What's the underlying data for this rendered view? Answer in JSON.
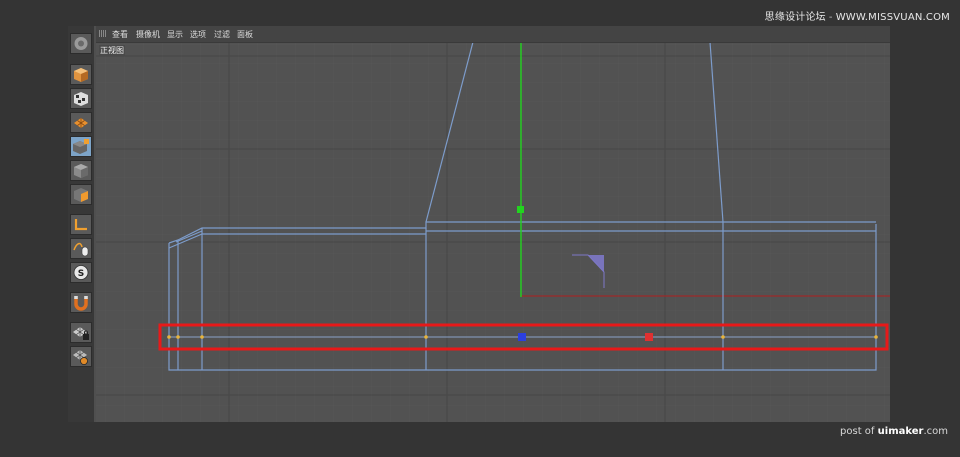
{
  "watermark_top": {
    "site_cn": "思缘设计论坛",
    "site_url": "WWW.MISSVUAN.COM"
  },
  "watermark_bottom": {
    "prefix": "post of",
    "brand": "uimaker",
    "suffix": ".com"
  },
  "menu": {
    "view": "查看",
    "cameras": "摄像机",
    "display": "显示",
    "options": "选项",
    "filter": "过滤",
    "panel": "面板"
  },
  "viewport": {
    "label": "正视图"
  },
  "toolbar": {
    "tools": [
      {
        "name": "app-logo-icon"
      },
      {
        "name": "cube-model-icon"
      },
      {
        "name": "checker-model-icon"
      },
      {
        "name": "texture-grid-icon"
      },
      {
        "name": "live-select-icon",
        "active": true
      },
      {
        "name": "object-mode-icon"
      },
      {
        "name": "polygon-mode-icon"
      },
      {
        "name": "axis-tool-icon"
      },
      {
        "name": "mouse-tweak-icon"
      },
      {
        "name": "snap-s-icon"
      },
      {
        "name": "magnet-icon"
      },
      {
        "name": "lock-grid-icon"
      },
      {
        "name": "grid-settings-icon"
      }
    ]
  },
  "colors": {
    "mesh": "#7d9ccb",
    "highlight": "#e81919",
    "y_axis": "#22d41f",
    "x_axis": "#c61e1e",
    "point_blue": "#2b3fe0",
    "point_red": "#e03030",
    "point_yellow": "#e8b43a"
  }
}
